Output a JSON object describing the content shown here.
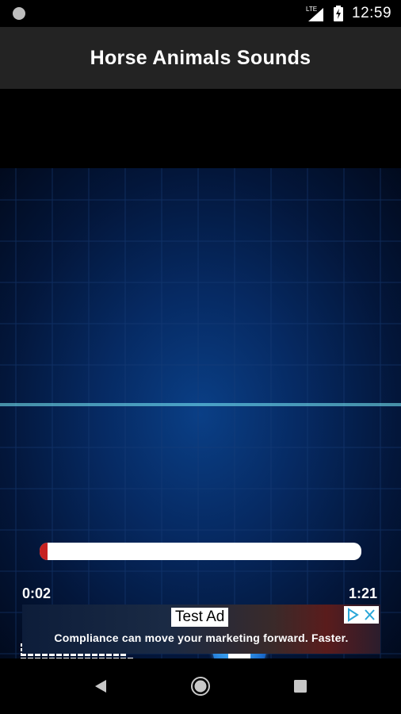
{
  "status_bar": {
    "time": "12:59",
    "network_icon": "lte-signal-icon",
    "battery_icon": "battery-charging-icon",
    "notification_icon": "circle-notification-icon"
  },
  "toolbar": {
    "title": "Horse Animals Sounds"
  },
  "player": {
    "current_time": "0:02",
    "total_time": "1:21",
    "progress_fraction": 0.025,
    "progress_color": "#c62121",
    "stop_icon": "stop-icon",
    "equalizer_icon": "equalizer-icon",
    "background_image": "sound-waveform"
  },
  "ad": {
    "label": "Test Ad",
    "text": "Compliance can move your marketing forward. Faster.",
    "choices_icon": "adchoices-icon"
  },
  "nav_bar": {
    "back_icon": "back-icon",
    "home_icon": "home-icon",
    "recents_icon": "recents-icon"
  },
  "colors": {
    "toolbar_bg": "#232323",
    "wave_color": "#3fd0e6",
    "accent": "#1766c8"
  }
}
